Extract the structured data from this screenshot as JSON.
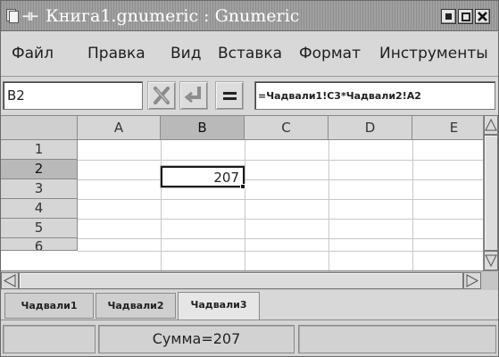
{
  "window": {
    "title": "Книга1.gnumeric : Gnumeric",
    "pin_glyph": "⊣⊢"
  },
  "menu": [
    "Файл",
    "Правка",
    "Вид",
    "Вставка",
    "Формат",
    "Инструменты"
  ],
  "formula_bar": {
    "cell_reference": "B2",
    "formula": "=Чадвали1!C3*Чадвали2!A2"
  },
  "grid": {
    "columns": [
      "A",
      "B",
      "C",
      "D",
      "E"
    ],
    "selected_column": "B",
    "rows": [
      "1",
      "2",
      "3",
      "4",
      "5",
      "6"
    ],
    "selected_row": "2",
    "active_cell_value": "207"
  },
  "sheets": [
    "Чадвали1",
    "Чадвали2",
    "Чадвали3"
  ],
  "active_sheet": "Чадвали3",
  "status": {
    "sum_text": "Сумма=207"
  },
  "icons": {
    "cancel": "x-mark-icon",
    "accept": "checkmark-icon",
    "equals": "equals-icon"
  }
}
